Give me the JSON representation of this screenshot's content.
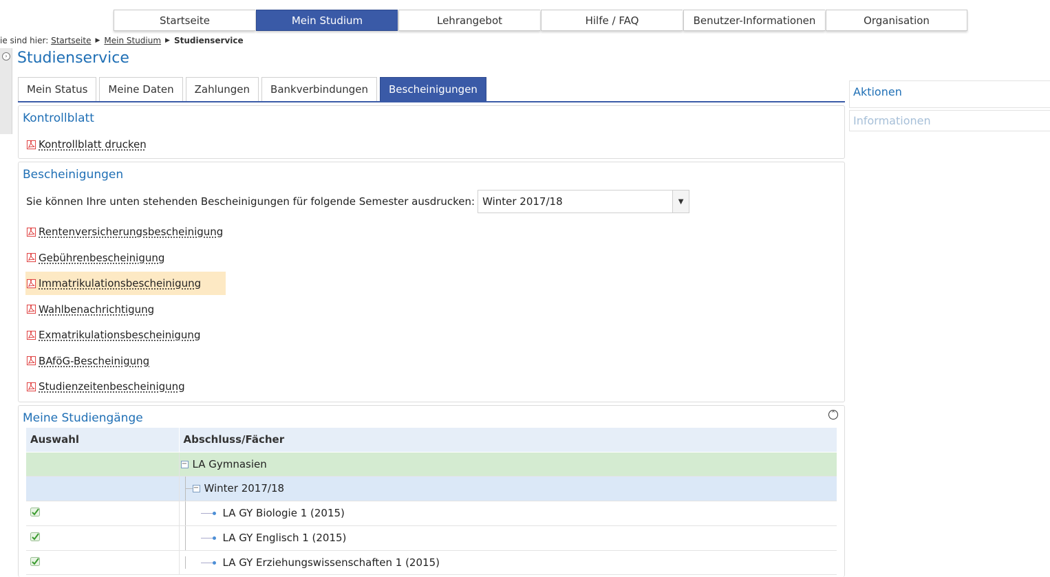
{
  "topnav": {
    "items": [
      {
        "label": "Startseite"
      },
      {
        "label": "Mein Studium"
      },
      {
        "label": "Lehrangebot"
      },
      {
        "label": "Hilfe / FAQ"
      },
      {
        "label": "Benutzer-Informationen"
      },
      {
        "label": "Organisation"
      }
    ],
    "active_index": 1
  },
  "breadcrumb": {
    "prefix": "ie sind hier:",
    "items": [
      "Startseite",
      "Mein Studium"
    ],
    "current": "Studienservice"
  },
  "page_title": "Studienservice",
  "tabs": [
    {
      "label": "Mein Status"
    },
    {
      "label": "Meine Daten"
    },
    {
      "label": "Zahlungen"
    },
    {
      "label": "Bankverbindungen"
    },
    {
      "label": "Bescheinigungen"
    }
  ],
  "kontrollblatt": {
    "title": "Kontrollblatt",
    "link": "Kontrollblatt drucken"
  },
  "bescheinigungen": {
    "title": "Bescheinigungen",
    "semester_prompt": "Sie können Ihre unten stehenden Bescheinigungen für folgende Semester ausdrucken:",
    "semester_selected": "Winter 2017/18",
    "links": [
      "Rentenversicherungsbescheinigung",
      "Gebührenbescheinigung",
      "Immatrikulationsbescheinigung",
      "Wahlbenachrichtigung",
      "Exmatrikulationsbescheinigung",
      "BAföG-Bescheinigung",
      "Studienzeitenbescheinigung"
    ],
    "highlighted_index": 2
  },
  "studiengaenge": {
    "title": "Meine Studiengänge",
    "columns": [
      "Auswahl",
      "Abschluss/Fächer"
    ],
    "degree": "LA Gymnasien",
    "semester": "Winter 2017/18",
    "subjects": [
      "LA GY Biologie 1 (2015)",
      "LA GY Englisch 1 (2015)",
      "LA GY Erziehungswissenschaften 1 (2015)"
    ]
  },
  "sidebar": {
    "aktionen": "Aktionen",
    "informationen": "Informationen"
  },
  "colors": {
    "accent": "#3a5aa7",
    "link_blue": "#1f6fb5",
    "highlight": "#fde9c4",
    "row_green": "#d4ebd1",
    "row_blue": "#dbe8f7"
  },
  "icons": {
    "pdf": "pdf-icon",
    "check": "check-icon",
    "collapse": "collapse-circle-icon"
  }
}
